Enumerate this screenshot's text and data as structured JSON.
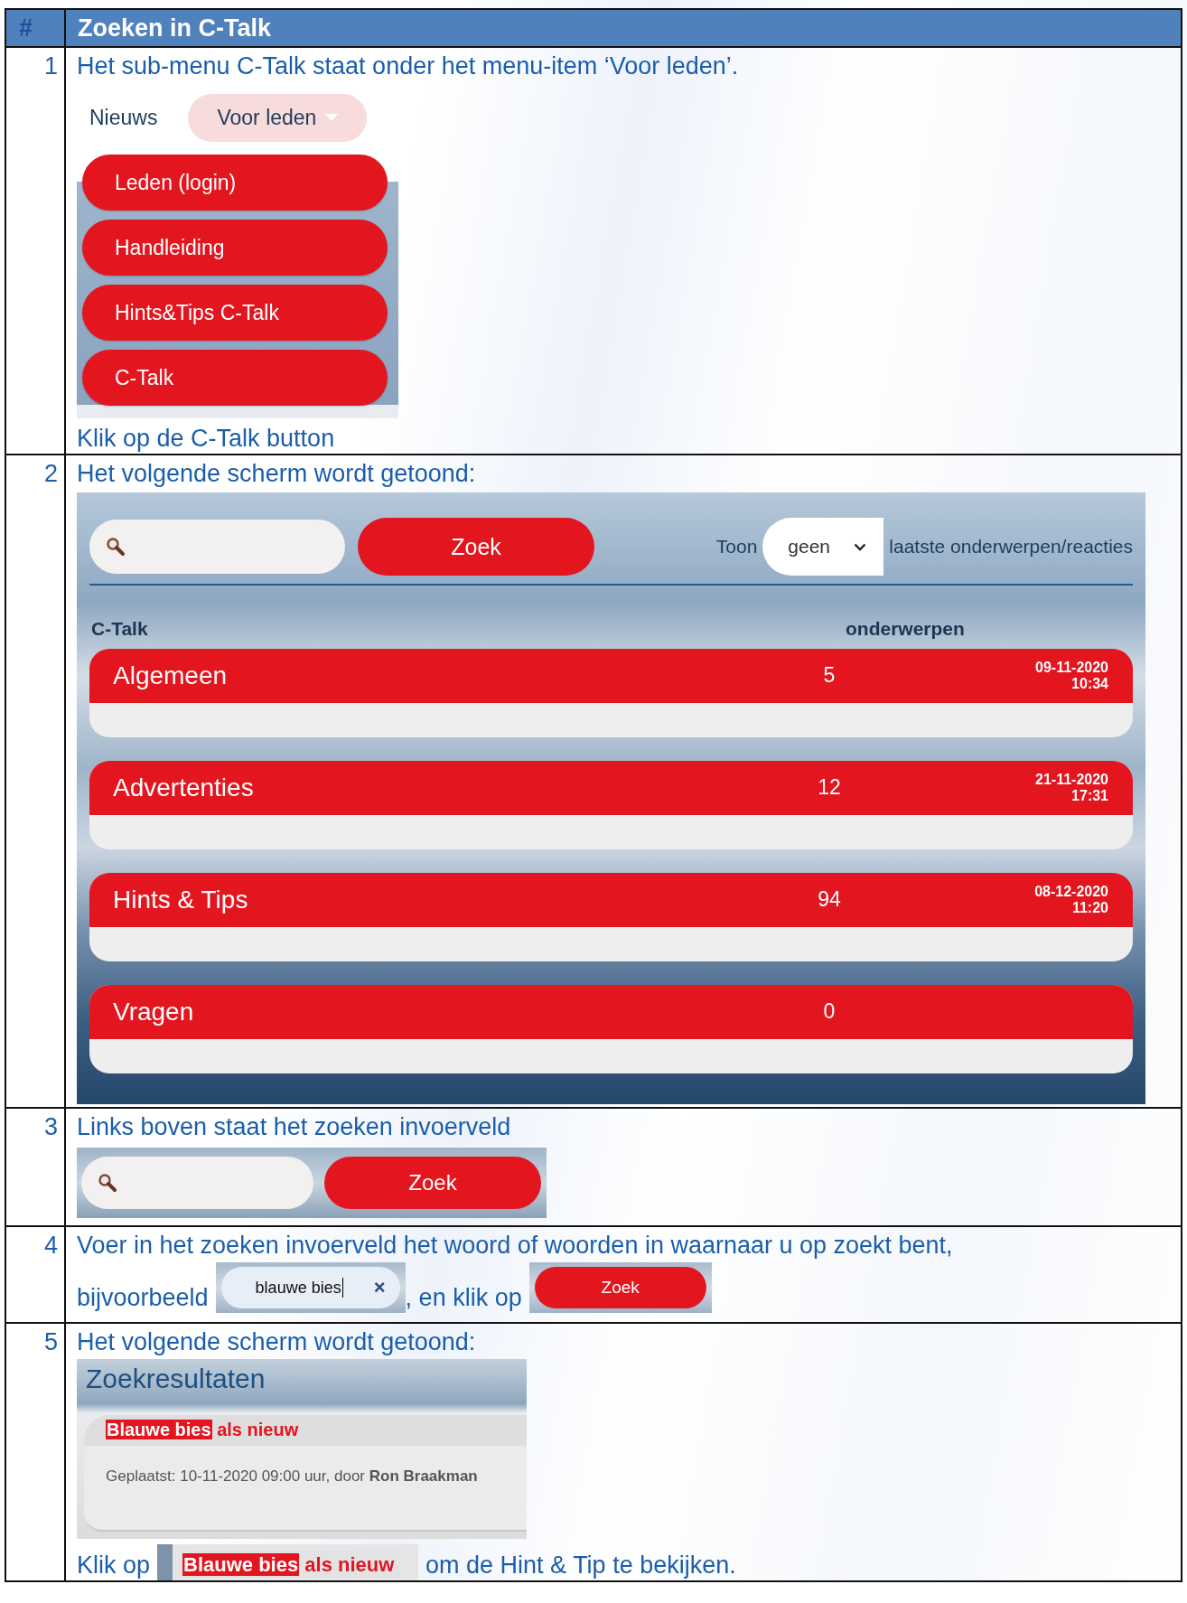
{
  "table": {
    "columns": [
      "#",
      "Zoeken in C-Talk"
    ],
    "steps": [
      {
        "number": "1",
        "kind": "menu",
        "text": "Het sub-menu C-Talk staat onder het menu-item ‘Voor leden’.",
        "nav": [
          {
            "label": "Nieuws",
            "selected": false
          },
          {
            "label": "Voor leden",
            "selected": true
          }
        ],
        "submenu": [
          "Leden (login)",
          "Handleiding",
          "Hints&Tips C-Talk",
          "C-Talk"
        ],
        "after": "Klik op de C-Talk button"
      },
      {
        "number": "2",
        "kind": "forum",
        "text": "Het volgende scherm wordt getoond:",
        "button": "Zoek",
        "show": {
          "label": "Toon",
          "value": "geen",
          "suffix": "laatste onderwerpen/reacties"
        },
        "columns": [
          "C-Talk",
          "onderwerpen"
        ],
        "forums": [
          {
            "name": "Algemeen",
            "count": "5",
            "date": "09-11-2020",
            "time": "10:34"
          },
          {
            "name": "Advertenties",
            "count": "12",
            "date": "21-11-2020",
            "time": "17:31"
          },
          {
            "name": "Hints & Tips",
            "count": "94",
            "date": "08-12-2020",
            "time": "11:20"
          },
          {
            "name": "Vragen",
            "count": "0"
          }
        ]
      },
      {
        "number": "3",
        "kind": "search",
        "text": "Links boven staat het zoeken invoerveld",
        "button": "Zoek"
      },
      {
        "number": "4",
        "kind": "example",
        "text": "Voer in het zoeken invoerveld het woord of woorden in waarnaar u op zoekt bent,",
        "before": "bijvoorbeeld",
        "value": "blauwe bies",
        "clear": "×",
        "middle": ", en klik op",
        "button": "Zoek"
      },
      {
        "number": "5",
        "kind": "results",
        "text": "Het volgende scherm wordt getoond:",
        "title": "Zoekresultaten",
        "result": {
          "match": "Blauwe bies",
          "rest": "als nieuw",
          "meta": "Geplaatst: 10-11-2020 09:00 uur, door **Ron Braakman**"
        },
        "before": "Klik op",
        "link": {
          "match": "Blauwe bies",
          "rest": "als nieuw"
        },
        "after": "om de Hint & Tip te bekijken."
      }
    ]
  }
}
